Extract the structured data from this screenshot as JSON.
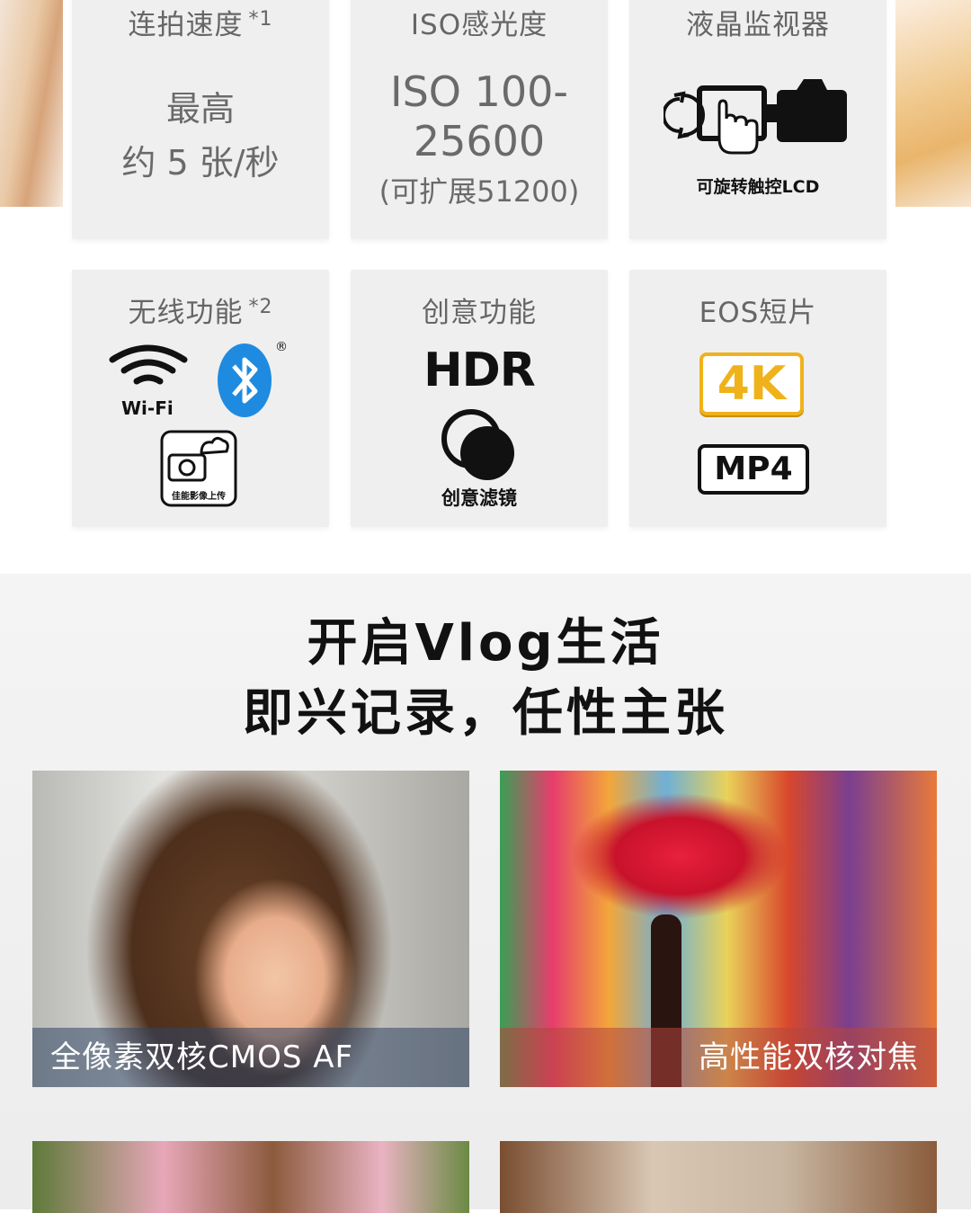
{
  "specs": {
    "burst": {
      "label": "连拍速度",
      "note": "*1",
      "line1": "最高",
      "line2": "约 5 张/秒"
    },
    "iso": {
      "label": "ISO感光度",
      "line1": "ISO 100-",
      "line2": "25600",
      "line3": "(可扩展51200)"
    },
    "lcd": {
      "label": "液晶监视器",
      "caption": "可旋转触控LCD"
    },
    "wireless": {
      "label": "无线功能",
      "note": "*2",
      "wifi": "Wi-Fi",
      "upload": "佳能影像上传",
      "bluetooth_mark": "®"
    },
    "creative": {
      "label": "创意功能",
      "hdr": "HDR",
      "filter": "创意滤镜"
    },
    "video": {
      "label": "EOS短片",
      "k4": "4K",
      "mp4": "MP4"
    }
  },
  "vlog": {
    "title1": "开启Vlog生活",
    "title2": "即兴记录，任性主张",
    "photos": [
      {
        "caption": "全像素双核CMOS AF"
      },
      {
        "caption": "高性能双核对焦"
      }
    ]
  },
  "colors": {
    "card_bg": "#efefef",
    "bluetooth": "#1e8be0",
    "k4_gold": "#f0b21b"
  },
  "icons": [
    "wifi-icon",
    "bluetooth-icon",
    "cloud-upload-icon",
    "rotate-icon",
    "touch-hand-icon",
    "camera-icon",
    "filter-circles-icon"
  ]
}
